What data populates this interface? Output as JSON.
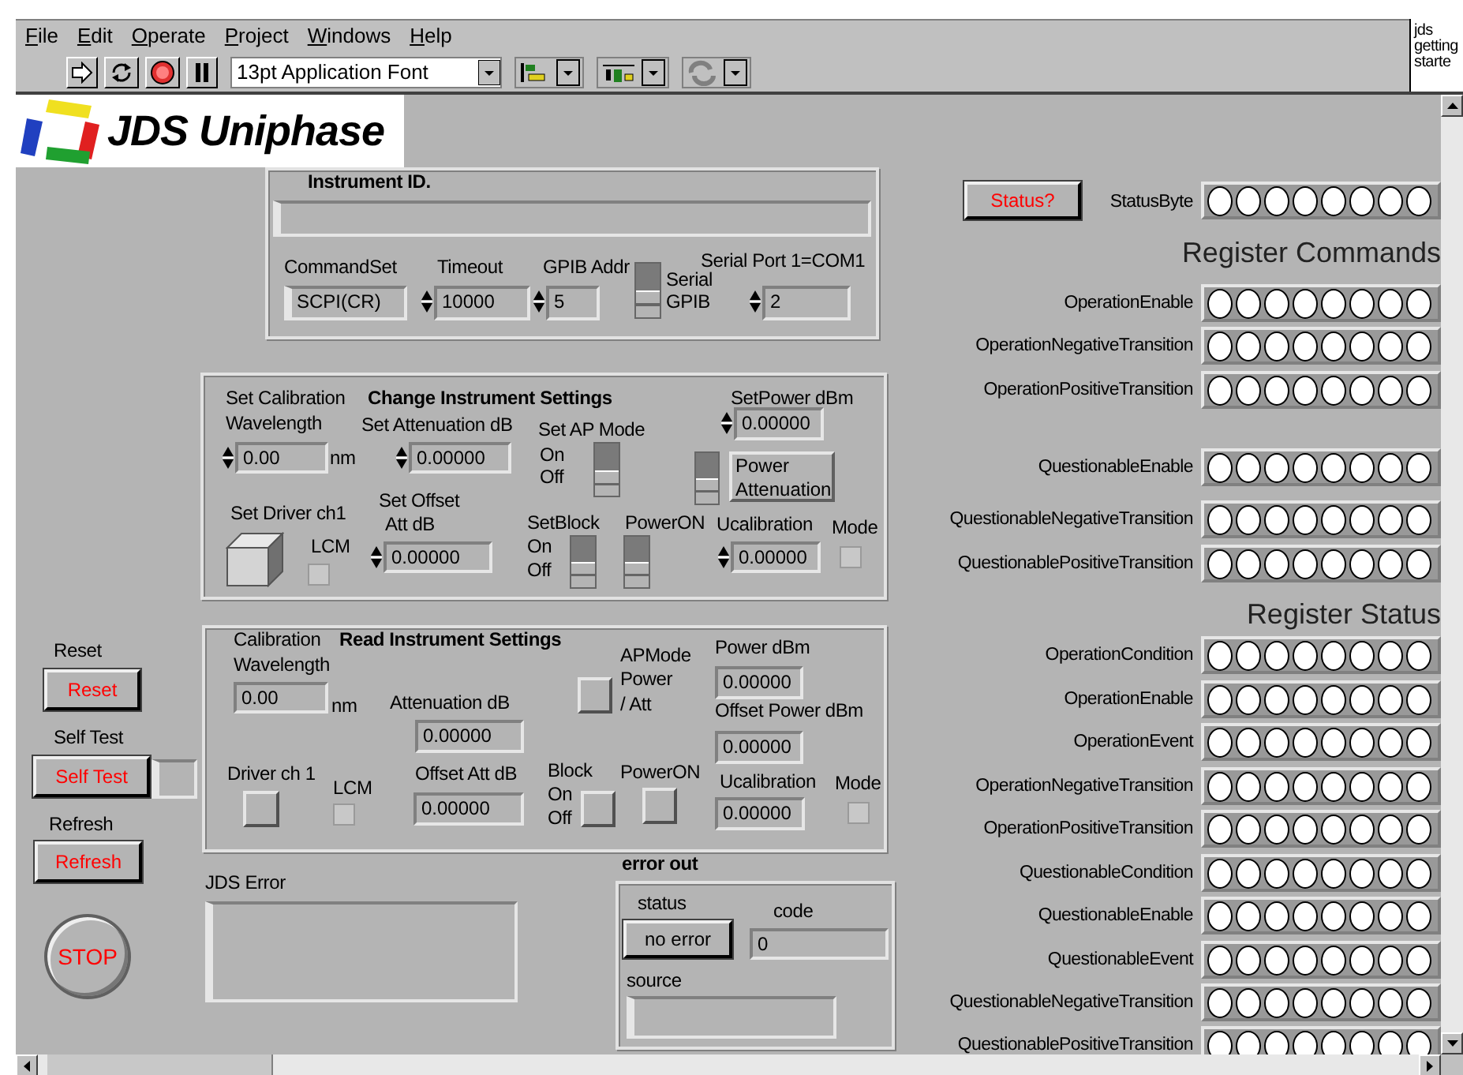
{
  "menu": [
    {
      "label": "File"
    },
    {
      "label": "Edit"
    },
    {
      "label": "Operate"
    },
    {
      "label": "Project"
    },
    {
      "label": "Windows"
    },
    {
      "label": "Help"
    }
  ],
  "toolbar": {
    "font": "13pt Application Font"
  },
  "side_note": "jds getting starte",
  "logo": {
    "text": "JDS Uniphase"
  },
  "instrument_id": {
    "items": [
      {
        "kind": "title",
        "text": "Instrument ID."
      },
      {
        "kind": "string"
      },
      {
        "kind": "label",
        "text": "CommandSet"
      },
      {
        "kind": "label",
        "text": "Timeout"
      },
      {
        "kind": "label",
        "text": "GPIB Addr"
      },
      {
        "kind": "label",
        "text": "Serial Port 1=COM1"
      },
      {
        "kind": "ring",
        "value": "SCPI(CR)"
      },
      {
        "kind": "numeric",
        "value": "10000"
      },
      {
        "kind": "numeric",
        "value": "5"
      },
      {
        "kind": "switch",
        "on": false
      },
      {
        "kind": "label",
        "text": "Serial"
      },
      {
        "kind": "label",
        "text": "GPIB"
      },
      {
        "kind": "numeric",
        "value": "2"
      }
    ]
  },
  "change_settings": {
    "items": [
      {
        "kind": "label",
        "text": "Set Calibration Wavelength"
      },
      {
        "kind": "title",
        "text": "Change Instrument Settings"
      },
      {
        "kind": "numeric",
        "value": "0.00"
      },
      {
        "kind": "label",
        "text": "nm"
      },
      {
        "kind": "label",
        "text": "Set Attenuation dB"
      },
      {
        "kind": "numeric",
        "value": "0.00000"
      },
      {
        "kind": "label",
        "text": "Set AP Mode"
      },
      {
        "kind": "label",
        "text": "On"
      },
      {
        "kind": "label",
        "text": "Off"
      },
      {
        "kind": "switch",
        "on": false
      },
      {
        "kind": "label",
        "text": "SetPower dBm"
      },
      {
        "kind": "numeric",
        "value": "0.00000"
      },
      {
        "kind": "switch",
        "on": false
      },
      {
        "kind": "caption",
        "text": "Power Attenuation"
      },
      {
        "kind": "label",
        "text": "Set Driver ch1"
      },
      {
        "kind": "cube",
        "on": false
      },
      {
        "kind": "label",
        "text": "LCM"
      },
      {
        "kind": "led",
        "on": false
      },
      {
        "kind": "label",
        "text": "Set Offset"
      },
      {
        "kind": "label",
        "text": "Att dB"
      },
      {
        "kind": "numeric",
        "value": "0.00000"
      },
      {
        "kind": "label",
        "text": "SetBlock"
      },
      {
        "kind": "label",
        "text": "PowerON"
      },
      {
        "kind": "label",
        "text": "On"
      },
      {
        "kind": "label",
        "text": "Off"
      },
      {
        "kind": "switch",
        "on": false
      },
      {
        "kind": "switch",
        "on": false
      },
      {
        "kind": "label",
        "text": "Ucalibration"
      },
      {
        "kind": "label",
        "text": "Mode"
      },
      {
        "kind": "numeric",
        "value": "0.00000"
      },
      {
        "kind": "led",
        "on": false
      }
    ]
  },
  "read_settings": {
    "items": [
      {
        "kind": "label",
        "text": "Calibration Wavelength"
      },
      {
        "kind": "title",
        "text": "Read Instrument Settings"
      },
      {
        "kind": "display",
        "value": "0.00"
      },
      {
        "kind": "label",
        "text": "nm"
      },
      {
        "kind": "label",
        "text": "Attenuation dB"
      },
      {
        "kind": "display",
        "value": "0.00000"
      },
      {
        "kind": "label",
        "text": "APMode"
      },
      {
        "kind": "label",
        "text": "Power / Att"
      },
      {
        "kind": "button",
        "on": false
      },
      {
        "kind": "label",
        "text": "Power dBm"
      },
      {
        "kind": "display",
        "value": "0.00000"
      },
      {
        "kind": "label",
        "text": "Offset Power dBm"
      },
      {
        "kind": "display",
        "value": "0.00000"
      },
      {
        "kind": "label",
        "text": "Driver ch 1"
      },
      {
        "kind": "label",
        "text": "LCM"
      },
      {
        "kind": "button",
        "on": false
      },
      {
        "kind": "led",
        "on": false
      },
      {
        "kind": "label",
        "text": "Offset Att dB"
      },
      {
        "kind": "display",
        "value": "0.00000"
      },
      {
        "kind": "label",
        "text": "Block"
      },
      {
        "kind": "label",
        "text": "On"
      },
      {
        "kind": "label",
        "text": "Off"
      },
      {
        "kind": "button",
        "on": false
      },
      {
        "kind": "label",
        "text": "PowerON"
      },
      {
        "kind": "button",
        "on": false
      },
      {
        "kind": "label",
        "text": "Ucalibration"
      },
      {
        "kind": "label",
        "text": "Mode"
      },
      {
        "kind": "display",
        "value": "0.00000"
      },
      {
        "kind": "led",
        "on": false
      }
    ]
  },
  "controls": {
    "items": [
      {
        "kind": "label",
        "text": "Reset"
      },
      {
        "kind": "text_button",
        "text": "Reset"
      },
      {
        "kind": "label",
        "text": "Self Test"
      },
      {
        "kind": "text_button",
        "text": "Self Test"
      },
      {
        "kind": "string_display"
      },
      {
        "kind": "label",
        "text": "Refresh"
      },
      {
        "kind": "text_button",
        "text": "Refresh"
      },
      {
        "kind": "round_button",
        "text": "STOP"
      }
    ]
  },
  "jds_error": {
    "items": [
      {
        "kind": "label",
        "text": "JDS Error"
      },
      {
        "kind": "string_display"
      }
    ]
  },
  "error_out": {
    "items": [
      {
        "kind": "title",
        "text": "error out"
      },
      {
        "kind": "label",
        "text": "status"
      },
      {
        "kind": "label",
        "text": "code"
      },
      {
        "kind": "status_button",
        "text": "no error"
      },
      {
        "kind": "display",
        "value": "0"
      },
      {
        "kind": "label",
        "text": "source"
      },
      {
        "kind": "string_display"
      }
    ]
  },
  "status_byte": {
    "button": "Status?",
    "label": "StatusByte",
    "leds": [
      false,
      false,
      false,
      false,
      false,
      false,
      false,
      false
    ]
  },
  "register_commands": {
    "title": "Register Commands",
    "rows": [
      {
        "label": "OperationEnable",
        "leds": [
          false,
          false,
          false,
          false,
          false,
          false,
          false,
          false
        ]
      },
      {
        "label": "OperationNegativeTransition",
        "leds": [
          false,
          false,
          false,
          false,
          false,
          false,
          false,
          false
        ]
      },
      {
        "label": "OperationPositiveTransition",
        "leds": [
          false,
          false,
          false,
          false,
          false,
          false,
          false,
          false
        ]
      },
      {
        "label": "QuestionableEnable",
        "leds": [
          false,
          false,
          false,
          false,
          false,
          false,
          false,
          false
        ]
      },
      {
        "label": "QuestionableNegativeTransition",
        "leds": [
          false,
          false,
          false,
          false,
          false,
          false,
          false,
          false
        ]
      },
      {
        "label": "QuestionablePositiveTransition",
        "leds": [
          false,
          false,
          false,
          false,
          false,
          false,
          false,
          false
        ]
      }
    ]
  },
  "register_status": {
    "title": "Register Status",
    "rows": [
      {
        "label": "OperationCondition",
        "leds": [
          false,
          false,
          false,
          false,
          false,
          false,
          false,
          false
        ]
      },
      {
        "label": "OperationEnable",
        "leds": [
          false,
          false,
          false,
          false,
          false,
          false,
          false,
          false
        ]
      },
      {
        "label": "OperationEvent",
        "leds": [
          false,
          false,
          false,
          false,
          false,
          false,
          false,
          false
        ]
      },
      {
        "label": "OperationNegativeTransition",
        "leds": [
          false,
          false,
          false,
          false,
          false,
          false,
          false,
          false
        ]
      },
      {
        "label": "OperationPositiveTransition",
        "leds": [
          false,
          false,
          false,
          false,
          false,
          false,
          false,
          false
        ]
      },
      {
        "label": "QuestionableCondition",
        "leds": [
          false,
          false,
          false,
          false,
          false,
          false,
          false,
          false
        ]
      },
      {
        "label": "QuestionableEnable",
        "leds": [
          false,
          false,
          false,
          false,
          false,
          false,
          false,
          false
        ]
      },
      {
        "label": "QuestionableEvent",
        "leds": [
          false,
          false,
          false,
          false,
          false,
          false,
          false,
          false
        ]
      },
      {
        "label": "QuestionableNegativeTransition",
        "leds": [
          false,
          false,
          false,
          false,
          false,
          false,
          false,
          false
        ]
      },
      {
        "label": "QuestionablePositiveTransition",
        "leds": [
          false,
          false,
          false,
          false,
          false,
          false,
          false,
          false
        ]
      }
    ]
  }
}
